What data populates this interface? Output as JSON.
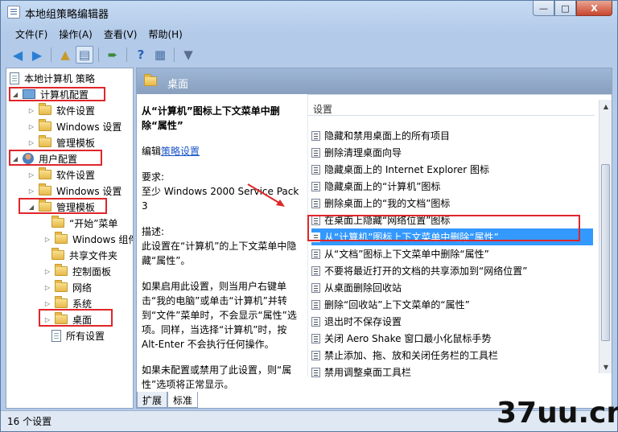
{
  "window": {
    "title": "本地组策略编辑器",
    "buttons": {
      "minimize": "—",
      "maximize": "□",
      "close": "X"
    }
  },
  "menu": [
    "文件(F)",
    "操作(A)",
    "查看(V)",
    "帮助(H)"
  ],
  "toolbar": {
    "icons": [
      "back-icon",
      "forward-icon",
      "folder-up-icon",
      "show-tree-icon",
      "export-icon",
      "help-icon",
      "properties-icon",
      "filter-icon"
    ]
  },
  "tree": {
    "root": "本地计算机 策略",
    "computer": "计算机配置",
    "computer_children": [
      "软件设置",
      "Windows 设置",
      "管理模板"
    ],
    "user": "用户配置",
    "user_children": [
      "软件设置",
      "Windows 设置"
    ],
    "admin_templates": "管理模板",
    "admin_children": [
      "“开始”菜单",
      "Windows 组件",
      "共享文件夹",
      "控制面板",
      "网络",
      "系统",
      "桌面",
      "所有设置"
    ]
  },
  "right": {
    "header": "桌面",
    "description": {
      "title": "从“计算机”图标上下文菜单中删除“属性”",
      "edit_prefix": "编辑",
      "edit_link": "策略设置",
      "requirement_label": "要求:",
      "requirement_text": "至少 Windows 2000 Service Pack 3",
      "desc_label": "描述:",
      "desc_text": "此设置在“计算机”的上下文菜单中隐藏“属性”。",
      "enabled_text": "如果启用此设置，则当用户右键单击“我的电脑”或单击“计算机”并转到“文件”菜单时，不会显示“属性”选项。同样，当选择“计算机”时，按 Alt-Enter 不会执行任何操作。",
      "disabled_text": "如果未配置或禁用了此设置，则“属性”选项将正常显示。"
    },
    "settings_header": "设置",
    "settings": [
      "隐藏和禁用桌面上的所有项目",
      "删除清理桌面向导",
      "隐藏桌面上的 Internet Explorer 图标",
      "隐藏桌面上的“计算机”图标",
      "删除桌面上的“我的文档”图标",
      "在桌面上隐藏“网络位置”图标",
      "从“计算机”图标上下文菜单中删除“属性”",
      "从“文档”图标上下文菜单中删除“属性”",
      "不要将最近打开的文档的共享添加到“网络位置”",
      "从桌面删除回收站",
      "删除“回收站”上下文菜单的“属性”",
      "退出时不保存设置",
      "关闭 Aero Shake 窗口最小化鼠标手势",
      "禁止添加、拖、放和关闭任务栏的工具栏",
      "禁用调整桌面工具栏"
    ],
    "tabs": [
      "扩展",
      "标准"
    ]
  },
  "status": "16 个设置",
  "watermark": "37uu.cn",
  "colors": {
    "selected": "#3399ff",
    "highlight_box": "#e0262a",
    "link": "#1a55c8"
  }
}
